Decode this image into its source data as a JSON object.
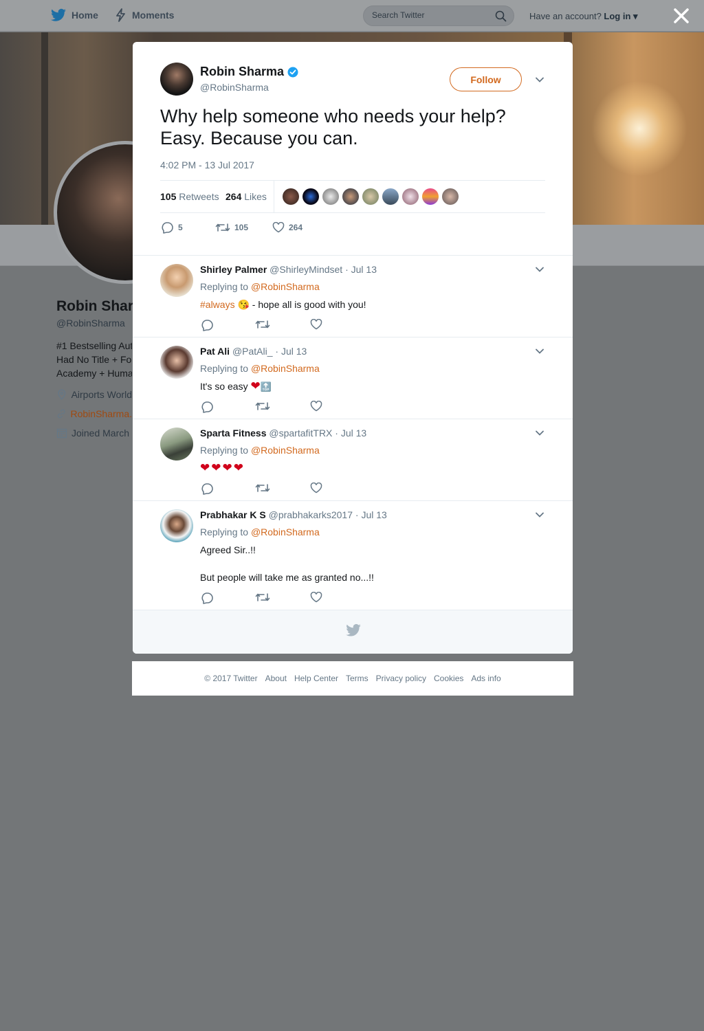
{
  "nav": {
    "home_label": "Home",
    "moments_label": "Moments",
    "search_placeholder": "Search Twitter",
    "account_prompt": "Have an account?",
    "login_label": "Log in"
  },
  "profile": {
    "name": "Robin Shar",
    "handle": "@RobinSharma",
    "bio_lines": [
      "#1 Bestselling Aut",
      "Had No Title + Fo",
      "Academy + Huma"
    ],
    "location": "Airports World",
    "website": "RobinSharma.",
    "joined": "Joined March"
  },
  "tweet": {
    "author_name": "Robin Sharma",
    "author_handle": "@RobinSharma",
    "follow_label": "Follow",
    "text": "Why help someone who needs your help? Easy. Because you can.",
    "timestamp": "4:02 PM - 13 Jul 2017",
    "retweets_count": "105",
    "retweets_label": "Retweets",
    "likes_count": "264",
    "likes_label": "Likes",
    "reply_count": "5",
    "retweet_action_count": "105",
    "like_action_count": "264",
    "colors": {
      "accent": "#d2691e",
      "verified": "#1da1f2"
    }
  },
  "replies": [
    {
      "name": "Shirley Palmer",
      "handle": "@ShirleyMindset",
      "date": "· Jul 13",
      "replying_prefix": "Replying to",
      "replying_to": "@RobinSharma",
      "hashtag": "#always",
      "emoji": "😘",
      "text": " - hope all is good with you!"
    },
    {
      "name": "Pat Ali",
      "handle": "@PatAli_",
      "date": "· Jul 13",
      "replying_prefix": "Replying to",
      "replying_to": "@RobinSharma",
      "text": "It's so easy",
      "emoji": "❤",
      "emoji2": "🔝"
    },
    {
      "name": "Sparta Fitness",
      "handle": "@spartafitTRX",
      "date": "· Jul 13",
      "replying_prefix": "Replying to",
      "replying_to": "@RobinSharma",
      "emoji": "❤❤❤❤"
    },
    {
      "name": "Prabhakar K S",
      "handle": "@prabhakarks2017",
      "date": "· Jul 13",
      "replying_prefix": "Replying to",
      "replying_to": "@RobinSharma",
      "text_line1": "Agreed Sir..!!",
      "text_line2": "But people will take me as granted no...!!"
    }
  ],
  "footer": {
    "links": [
      "© 2017 Twitter",
      "About",
      "Help Center",
      "Terms",
      "Privacy policy",
      "Cookies",
      "Ads info"
    ]
  }
}
